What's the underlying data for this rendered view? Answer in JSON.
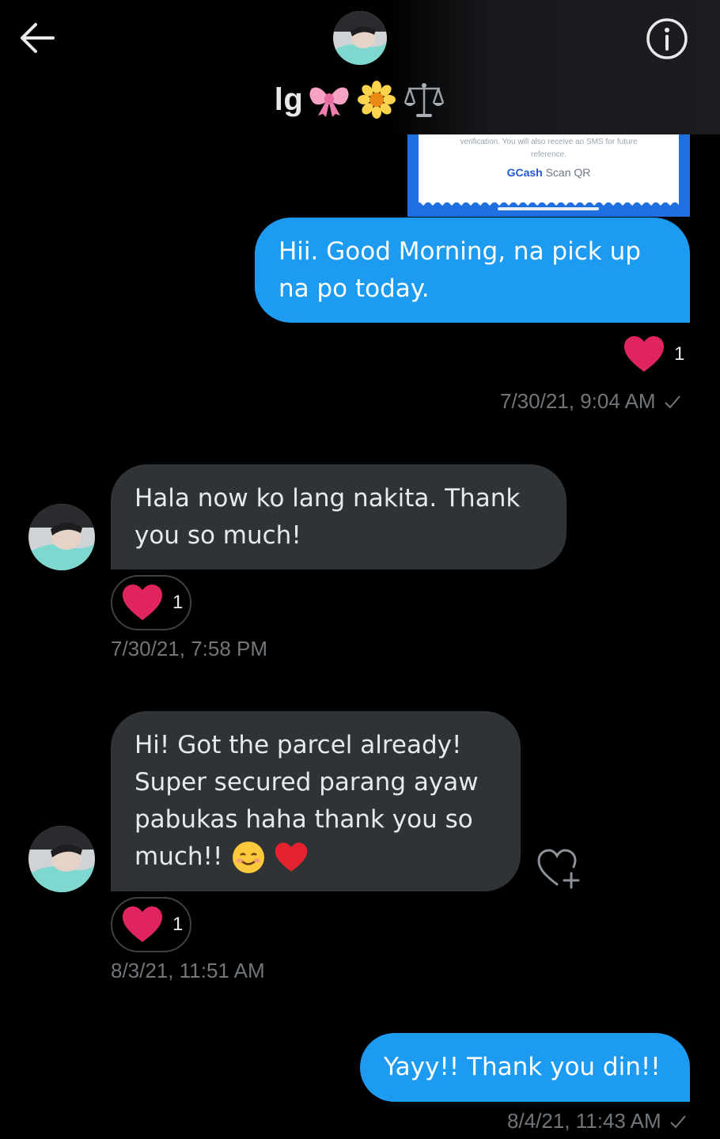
{
  "header": {
    "back_icon": "arrow-left-icon",
    "info_icon": "info-circle-icon",
    "title": "lg",
    "title_emojis": [
      "ribbon-emoji",
      "blossom-emoji",
      "balance-scale-emoji"
    ]
  },
  "shared_image": {
    "text_line1": "verification. You will also receive an SMS for future",
    "text_line2": "reference.",
    "brand": "GCash",
    "brand_suffix": " Scan QR"
  },
  "messages": [
    {
      "sender": "me",
      "lines": [
        "Hii. Good Morning, na pick up",
        "na po today."
      ],
      "reaction": {
        "icon": "heart-icon",
        "count": "1"
      },
      "timestamp": "7/30/21, 9:04 AM",
      "status_icon": "check-icon"
    },
    {
      "sender": "them",
      "lines": [
        "Hala now ko lang nakita. Thank",
        "you so much!"
      ],
      "reaction": {
        "icon": "heart-icon",
        "count": "1"
      },
      "timestamp": "7/30/21, 7:58 PM"
    },
    {
      "sender": "them",
      "lines": [
        "Hi! Got the parcel already!",
        "Super secured parang ayaw",
        "pabukas haha thank you so",
        "much!!"
      ],
      "line_emojis": [
        "smiling-face-emoji",
        "red-heart-emoji"
      ],
      "reaction": {
        "icon": "heart-icon",
        "count": "1"
      },
      "timestamp": "8/3/21, 11:51 AM",
      "add_reaction_icon": "heart-plus-icon"
    },
    {
      "sender": "me",
      "lines": [
        "Yayy!! Thank you din!!"
      ],
      "timestamp": "8/4/21, 11:43 AM",
      "status_icon": "check-icon"
    }
  ],
  "colors": {
    "background": "#000000",
    "sent_bubble": "#1d9bf0",
    "received_bubble": "#2f3336",
    "heart": "#e0245e",
    "muted_text": "#71767b"
  }
}
